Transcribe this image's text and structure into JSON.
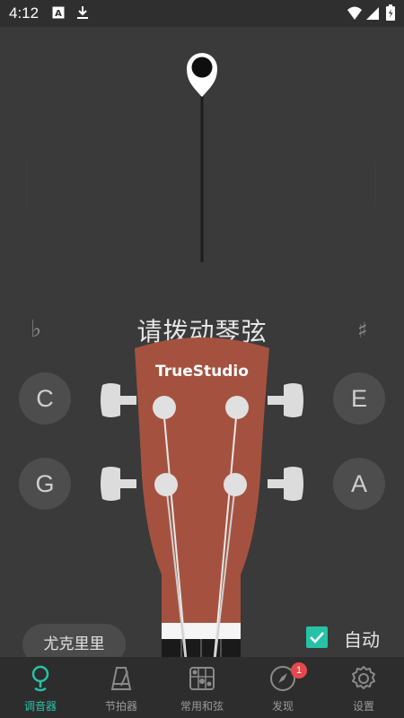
{
  "status_bar": {
    "time": "4:12"
  },
  "tuner": {
    "prompt": "请拨动琴弦",
    "flat_symbol": "♭",
    "sharp_symbol": "♯",
    "brand": "TrueStudio",
    "notes": {
      "upper_left": "C",
      "lower_left": "G",
      "upper_right": "E",
      "lower_right": "A"
    },
    "instrument_label": "尤克里里",
    "auto_label": "自动",
    "auto_checked": true
  },
  "nav": {
    "items": [
      {
        "label": "调音器",
        "icon": "tuner-pin-icon",
        "active": true
      },
      {
        "label": "节拍器",
        "icon": "metronome-icon",
        "active": false
      },
      {
        "label": "常用和弦",
        "icon": "chord-grid-icon",
        "active": false
      },
      {
        "label": "发现",
        "icon": "compass-icon",
        "active": false,
        "badge": "1"
      },
      {
        "label": "设置",
        "icon": "gear-icon",
        "active": false
      }
    ]
  },
  "colors": {
    "accent": "#27c1a7",
    "headstock": "#a4523f",
    "background": "#3a3a3a",
    "badge": "#e5484d"
  }
}
